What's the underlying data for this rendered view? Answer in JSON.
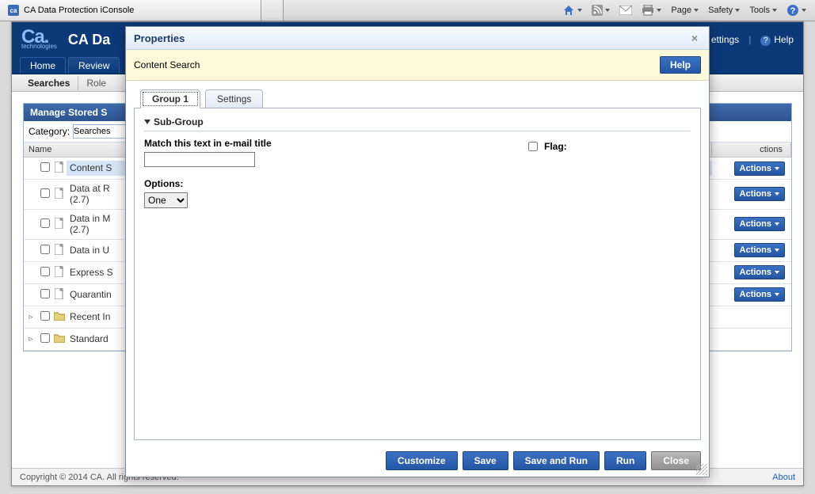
{
  "chrome": {
    "tab_title": "CA Data Protection iConsole",
    "favicon_text": "ca",
    "menus": {
      "page": "Page",
      "safety": "Safety",
      "tools": "Tools"
    }
  },
  "header": {
    "logo_sub": "technologies",
    "app_title": "CA Da",
    "settings": "ettings",
    "help": "Help"
  },
  "nav": {
    "home": "Home",
    "review": "Review"
  },
  "subnav": {
    "searches": "Searches",
    "role": "Role "
  },
  "panel": {
    "title": "Manage Stored S",
    "category_label": "Category:",
    "category_value": "Searches",
    "col_name": "Name",
    "col_actions": "ctions",
    "actions_btn": "Actions",
    "rows": [
      {
        "name": "Content S",
        "selected": true,
        "type": "doc",
        "expandable": false
      },
      {
        "name": "Data at R\n(2.7)",
        "selected": false,
        "type": "doc",
        "expandable": false
      },
      {
        "name": "Data in M\n(2.7)",
        "selected": false,
        "type": "doc",
        "expandable": false
      },
      {
        "name": "Data in U",
        "selected": false,
        "type": "doc",
        "expandable": false
      },
      {
        "name": "Express S",
        "selected": false,
        "type": "doc",
        "expandable": false
      },
      {
        "name": "Quarantin",
        "selected": false,
        "type": "doc",
        "expandable": false
      },
      {
        "name": "Recent In",
        "selected": false,
        "type": "folder",
        "expandable": true
      },
      {
        "name": "Standard",
        "selected": false,
        "type": "folder",
        "expandable": true
      }
    ]
  },
  "footer": {
    "copyright": "Copyright © 2014 CA. All rights reserved.",
    "about": "About"
  },
  "modal": {
    "title": "Properties",
    "subtitle": "Content Search",
    "help": "Help",
    "tabs": {
      "group1": "Group 1",
      "settings": "Settings"
    },
    "subgroup": "Sub-Group",
    "match_label": "Match this text in e-mail title",
    "match_value": "",
    "options_label": "Options:",
    "options_value": "One",
    "flag_label": "Flag:",
    "buttons": {
      "customize": "Customize",
      "save": "Save",
      "save_run": "Save and Run",
      "run": "Run",
      "close": "Close"
    }
  }
}
